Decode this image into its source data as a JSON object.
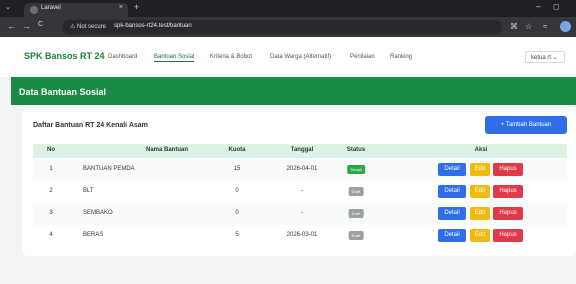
{
  "browser": {
    "tab_title": "Laravel",
    "tab_close": "×",
    "new_tab": "+",
    "not_secure": "⚠ Not secure",
    "url": "spk-bansos-rt24.test/bantuan",
    "menu_glyph": "⌄",
    "back_glyph": "←",
    "forward_glyph": "→",
    "reload_glyph": "C",
    "minimize_glyph": "–",
    "restore_glyph": "◻"
  },
  "navbar": {
    "brand": "SPK Bansos RT 24",
    "links": [
      "Dashboard",
      "Bantuan Sosial",
      "Kriteria & Bobot",
      "Data Warga (Alternatif)",
      "Penilaian",
      "Ranking"
    ],
    "active_index": 1,
    "user": "ketua rt ⌄"
  },
  "header": {
    "title": "Data Bantuan Sosial"
  },
  "card": {
    "title": "Daftar Bantuan RT 24 Kenali Asam",
    "add_button": "+ Tambah Bantuan"
  },
  "table": {
    "headers": [
      "No",
      "Nama Bantuan",
      "Kuota",
      "Tanggal",
      "Status",
      "Aksi"
    ],
    "rows": [
      {
        "no": "1",
        "nama": "BANTUAN PEMDA",
        "kuota": "15",
        "tanggal": "2026-04-01",
        "status": "Tampil"
      },
      {
        "no": "2",
        "nama": "BLT",
        "kuota": "0",
        "tanggal": "-",
        "status": "Draft"
      },
      {
        "no": "3",
        "nama": "SEMBAKO",
        "kuota": "0",
        "tanggal": "-",
        "status": "Draft"
      },
      {
        "no": "4",
        "nama": "BERAS",
        "kuota": "5",
        "tanggal": "2026-03-01",
        "status": "Draft"
      }
    ],
    "actions": {
      "detail": "Detail",
      "edit": "Edit",
      "hapus": "Hapus"
    }
  },
  "colors": {
    "brand_green": "#1a8a47",
    "primary_blue": "#2f6ee8",
    "warning_yellow": "#f2b90f",
    "danger_red": "#e0394a",
    "badge_tampil": "#28a745",
    "badge_draft": "#9aa0a6"
  }
}
